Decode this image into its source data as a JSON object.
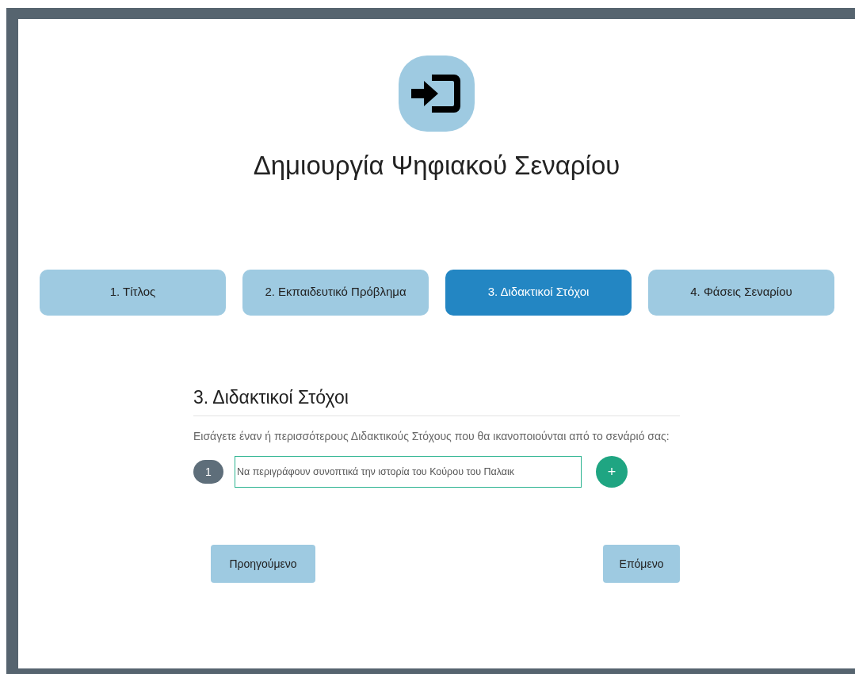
{
  "title": "Δημιουργία Ψηφιακού Σεναρίου",
  "steps": [
    {
      "label": "1. Τίτλος",
      "selected": false
    },
    {
      "label": "2. Εκπαιδευτικό Πρόβλημα",
      "selected": false
    },
    {
      "label": "3. Διδακτικοί Στόχοι",
      "selected": true
    },
    {
      "label": "4. Φάσεις Σεναρίου",
      "selected": false
    }
  ],
  "section": {
    "heading": "3. Διδακτικοί Στόχοι",
    "instructions": "Εισάγετε έναν ή περισσότερους Διδακτικούς Στόχους που θα ικανοποιούνται από το σενάριό σας:",
    "goals": [
      {
        "number": "1",
        "value": "Να περιγράφουν συνοπτικά την ιστορία του Κούρου του Παλαικ"
      }
    ],
    "add_button": "+"
  },
  "buttons": {
    "previous": "Προηγούμενο",
    "next": "Επόμενο"
  }
}
